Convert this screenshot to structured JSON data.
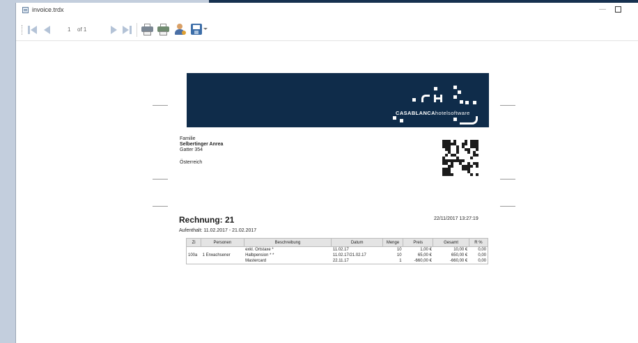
{
  "window": {
    "title": "invoice.trdx"
  },
  "toolbar": {
    "page_current": "1",
    "page_of": "of 1"
  },
  "invoice": {
    "recipient": [
      "Familie",
      "Selbertinger Anrea",
      "Gatter 354",
      "Österreich"
    ],
    "title": "Rechnung: 21",
    "datetime": "22/11/2017 13:27:19",
    "stay": "Aufenthalt: 11.02.2017 - 21.02.2017",
    "logo_text_bold": "CASABLANCA",
    "logo_text_light": "hotelsoftware",
    "headers": [
      "Zi",
      "Personen",
      "Beschreibung",
      "Datum",
      "Menge",
      "Preis",
      "Gesamt",
      "R %"
    ],
    "rows": [
      [
        "",
        "",
        "exkl. Ortstaxe *",
        "11.02.17",
        "10",
        "1,00 €",
        "10,00 €",
        "0,00"
      ],
      [
        "100a",
        "1 Erwachsener",
        "Halbpension * *",
        "11.02.17/21.02.17",
        "10",
        "65,00 €",
        "650,00 €",
        "0,00"
      ],
      [
        "",
        "",
        "Mastercard",
        "22.11.17",
        "1",
        "-660,00 €",
        "-660,00 €",
        "0,00"
      ]
    ]
  },
  "colors": {
    "banner": "#0f2c4a",
    "nav_disabled": "#b4c3d7",
    "desktop": "#c3cedd"
  }
}
